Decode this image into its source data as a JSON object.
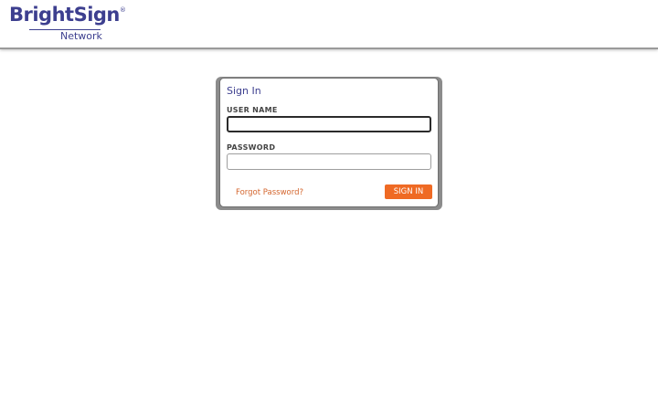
{
  "header": {
    "logo": {
      "brand": "BrightSign",
      "registered": "®",
      "product": "Network"
    }
  },
  "signin": {
    "title": "Sign In",
    "username_label": "USER NAME",
    "username_value": "",
    "password_label": "PASSWORD",
    "password_value": "",
    "forgot_link": "Forgot Password?",
    "submit_label": "SIGN IN"
  },
  "colors": {
    "brand_purple": "#3d3f8f",
    "accent_orange": "#ef6a24",
    "link_orange": "#d4662e"
  }
}
